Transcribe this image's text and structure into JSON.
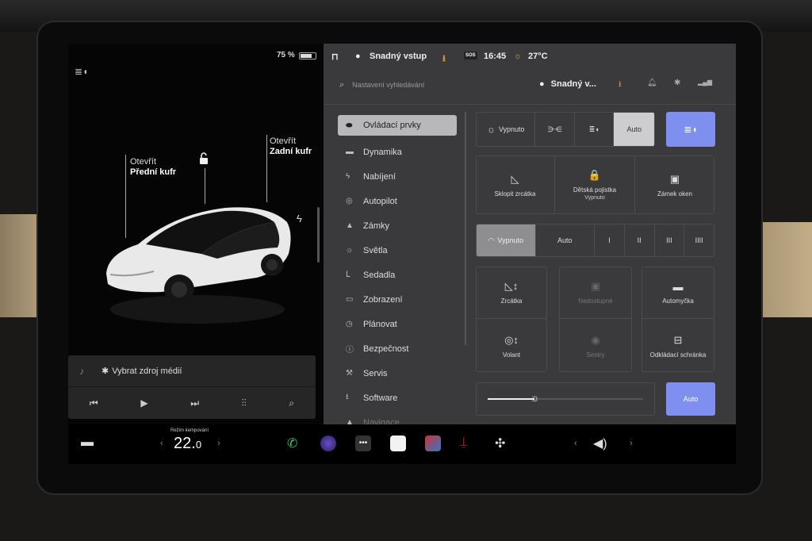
{
  "status": {
    "battery_percent": "75 %",
    "battery_level": 0.75,
    "profile": "Snadný vstup",
    "time": "16:45",
    "temperature": "27°C",
    "sos": "SOS"
  },
  "car_view": {
    "frunk_action": "Otevřít",
    "frunk_label": "Přední kufr",
    "trunk_action": "Otevřít",
    "trunk_label": "Zadní kufr"
  },
  "media": {
    "source_label": "Vybrat zdroj médií",
    "bluetooth_glyph": "✱"
  },
  "search": {
    "placeholder": "Nastavení vyhledávání"
  },
  "header": {
    "profile_short": "Snadný v..."
  },
  "menu": {
    "items": [
      {
        "label": "Ovládací prvky",
        "icon": "toggle-icon",
        "glyph": "⬬"
      },
      {
        "label": "Dynamika",
        "icon": "car-icon",
        "glyph": "▬"
      },
      {
        "label": "Nabíjení",
        "icon": "bolt-icon",
        "glyph": "ϟ"
      },
      {
        "label": "Autopilot",
        "icon": "steering-wheel-icon",
        "glyph": "◎"
      },
      {
        "label": "Zámky",
        "icon": "lock-icon",
        "glyph": "▲"
      },
      {
        "label": "Světla",
        "icon": "sun-icon",
        "glyph": "☼"
      },
      {
        "label": "Sedadla",
        "icon": "seat-icon",
        "glyph": "ᒪ"
      },
      {
        "label": "Zobrazení",
        "icon": "display-icon",
        "glyph": "▭"
      },
      {
        "label": "Plánovat",
        "icon": "alarm-clock-icon",
        "glyph": "◷"
      },
      {
        "label": "Bezpečnost",
        "icon": "alert-circle-icon",
        "glyph": "ⓘ"
      },
      {
        "label": "Servis",
        "icon": "wrench-icon",
        "glyph": "⚒"
      },
      {
        "label": "Software",
        "icon": "download-icon",
        "glyph": "⭳"
      },
      {
        "label": "Navigace",
        "icon": "navigation-icon",
        "glyph": "▲"
      }
    ]
  },
  "lights": {
    "off": "Vypnuto",
    "auto": "Auto",
    "selected": "Auto",
    "auto_headlights_glyph": "≣◖"
  },
  "tiles_row1": [
    {
      "label": "Sklopit zrcátka",
      "sub": "",
      "icon": "mirror-icon",
      "glyph": "◺"
    },
    {
      "label": "Dětská pojistka",
      "sub": "Vypnuto",
      "icon": "child-lock-icon",
      "glyph": "🔒"
    },
    {
      "label": "Zámek oken",
      "sub": "",
      "icon": "window-lock-icon",
      "glyph": "▣"
    }
  ],
  "wipers": {
    "off": "Vypnuto",
    "auto": "Auto",
    "levels": [
      "I",
      "II",
      "III",
      "IIII"
    ],
    "selected": "Vypnuto"
  },
  "tiles_grid": [
    {
      "label": "Zrcátka",
      "sub": "",
      "icon": "mirror-adjust-icon",
      "glyph": "◺↕",
      "disabled": false
    },
    {
      "label": "Nedostupné",
      "sub": "",
      "icon": "camera-icon",
      "glyph": "▣",
      "disabled": true
    },
    {
      "label": "Automyčka",
      "sub": "",
      "icon": "car-wash-icon",
      "glyph": "▬",
      "disabled": false
    },
    {
      "label": "Volant",
      "sub": "",
      "icon": "steering-adjust-icon",
      "glyph": "◎↕",
      "disabled": false
    },
    {
      "label": "Sentry",
      "sub": "",
      "icon": "sentry-icon",
      "glyph": "◉",
      "disabled": true
    },
    {
      "label": "Odkládací schránka",
      "sub": "",
      "icon": "glovebox-icon",
      "glyph": "⊟",
      "disabled": false
    }
  ],
  "brightness": {
    "level": 0.3,
    "auto": "Auto"
  },
  "dock": {
    "climate_mode": "Režim kempování",
    "temp_whole": "22.",
    "temp_decimal": "0"
  }
}
